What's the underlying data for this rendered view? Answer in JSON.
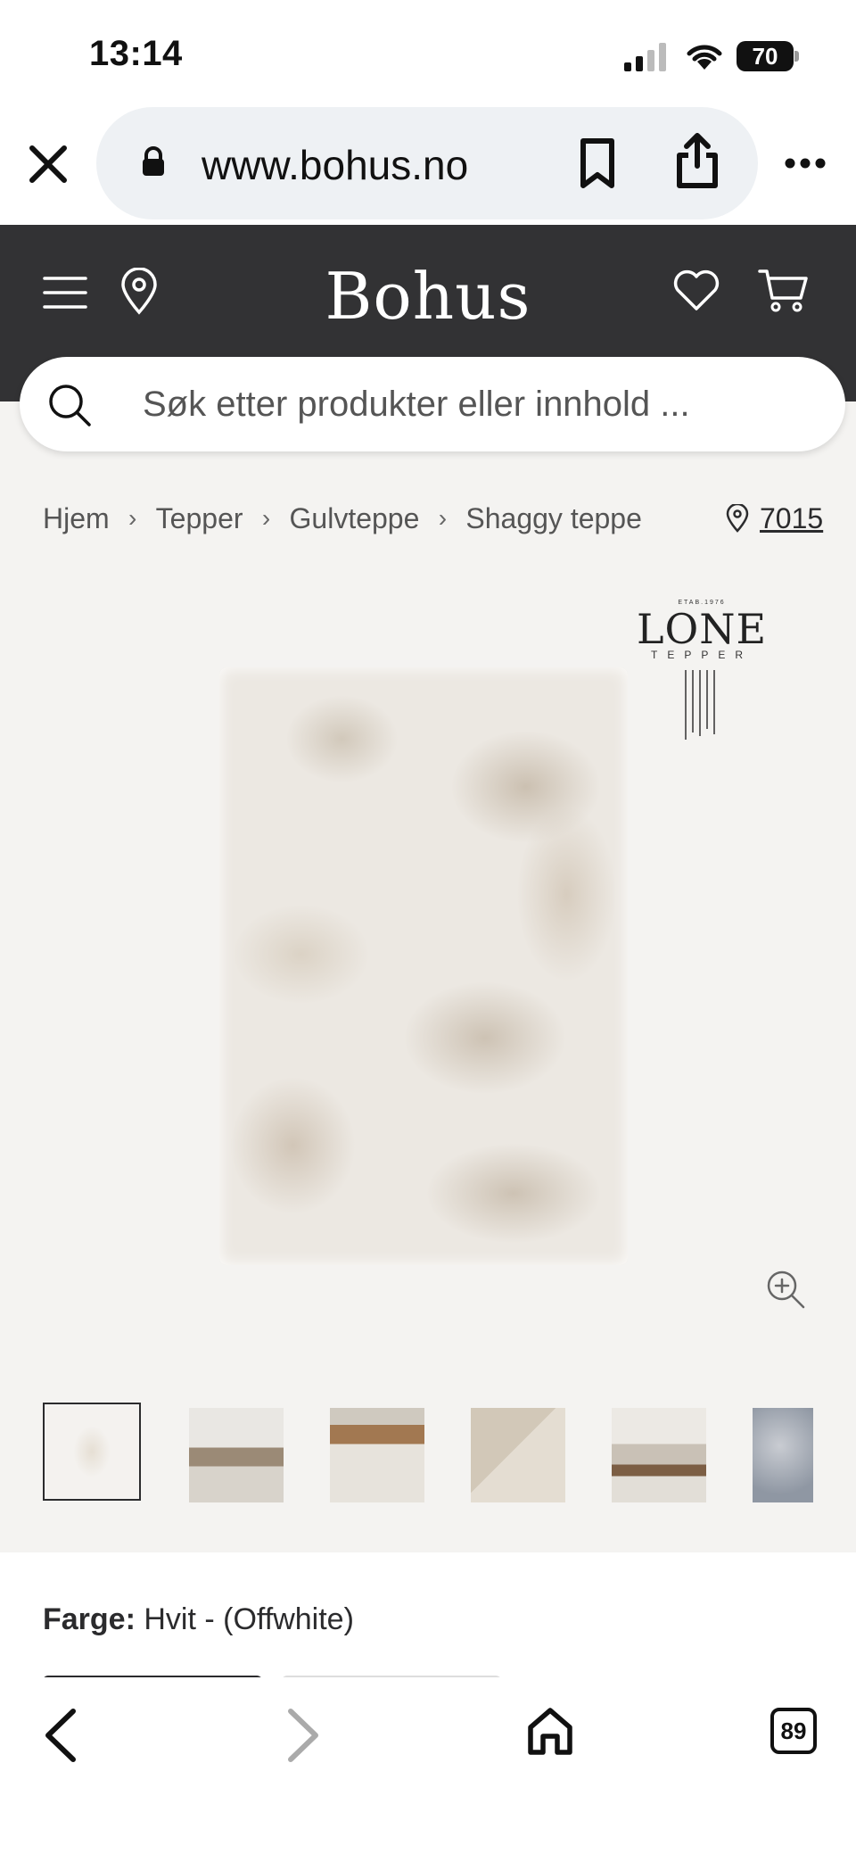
{
  "status_bar": {
    "time": "13:14",
    "battery": "70"
  },
  "browser": {
    "url": "www.bohus.no",
    "tab_count": "89"
  },
  "header": {
    "logo": "Bohus"
  },
  "search": {
    "placeholder": "Søk etter produkter eller innhold ..."
  },
  "breadcrumb": [
    "Hjem",
    "Tepper",
    "Gulvteppe",
    "Shaggy teppe"
  ],
  "store": {
    "code": "7015"
  },
  "brand_logo": {
    "etab": "ETAB.1976",
    "name": "LONE",
    "sub": "TEPPER"
  },
  "product": {
    "color_label": "Farge:",
    "color_value": "Hvit - (Offwhite)"
  },
  "thumbnails": [
    {
      "name": "thumb-rug-front",
      "selected": true
    },
    {
      "name": "thumb-living-room",
      "selected": false
    },
    {
      "name": "thumb-coffee-table",
      "selected": false
    },
    {
      "name": "thumb-rug-corner",
      "selected": false
    },
    {
      "name": "thumb-living-room-2",
      "selected": false
    },
    {
      "name": "thumb-rug-closeup",
      "selected": false
    }
  ],
  "colors": {
    "header_bg": "#323234",
    "page_bg": "#f4f3f1",
    "text": "#2b2b2d"
  },
  "icons": [
    "close-icon",
    "lock-icon",
    "bookmark-icon",
    "share-icon",
    "more-icon",
    "menu-icon",
    "location-pin-icon",
    "heart-icon",
    "cart-icon",
    "search-icon",
    "zoom-in-icon",
    "back-icon",
    "forward-icon",
    "home-icon",
    "tabs-icon"
  ]
}
